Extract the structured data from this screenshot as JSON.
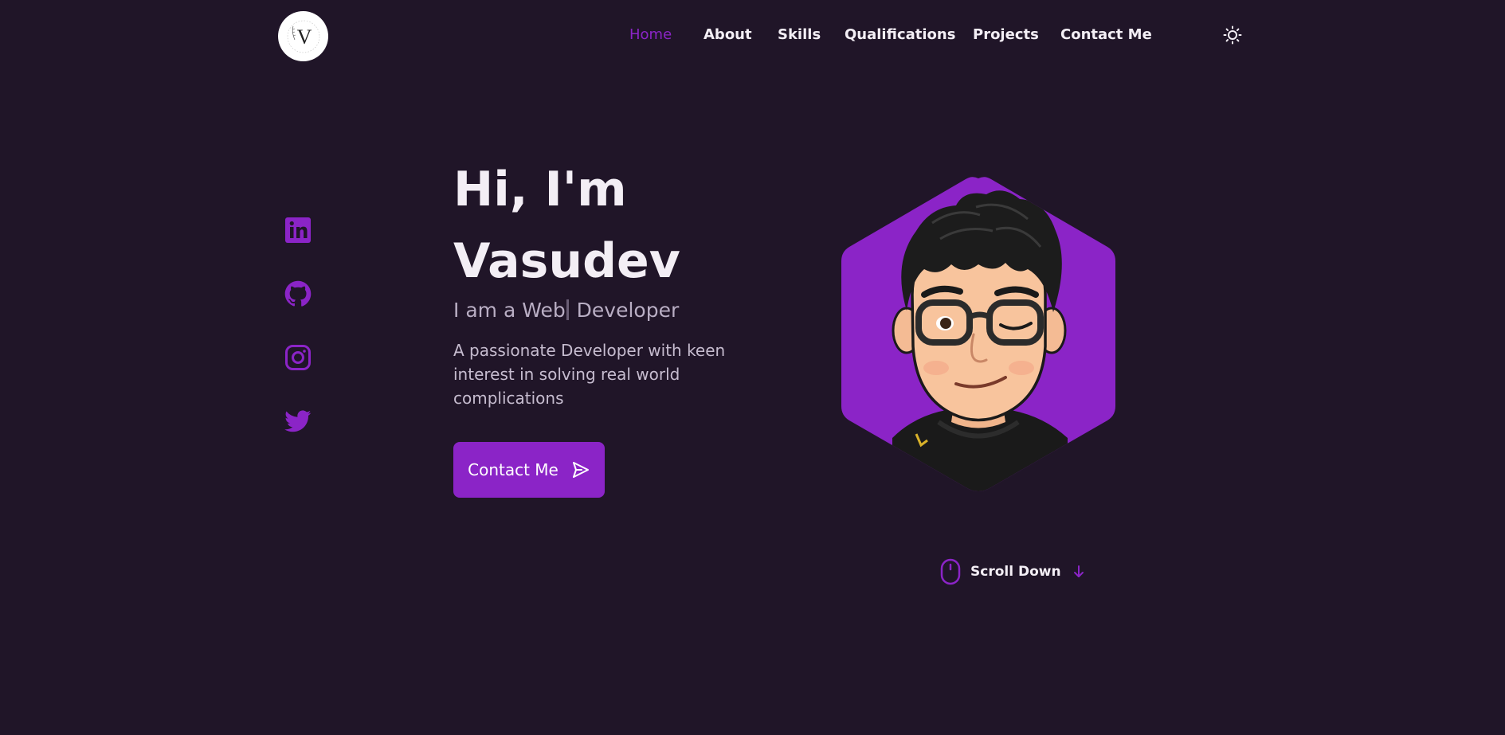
{
  "header": {
    "logo_letter": "V",
    "nav": [
      {
        "label": "Home",
        "active": true
      },
      {
        "label": "About",
        "active": false
      },
      {
        "label": "Skills",
        "active": false
      },
      {
        "label": "Qualifications",
        "active": false
      },
      {
        "label": "Projects",
        "active": false
      },
      {
        "label": "Contact Me",
        "active": false
      }
    ],
    "theme_icon": "sun-icon"
  },
  "social": [
    {
      "name": "linkedin-icon"
    },
    {
      "name": "github-icon"
    },
    {
      "name": "instagram-icon"
    },
    {
      "name": "twitter-icon"
    }
  ],
  "hero": {
    "greeting": "Hi, I'm",
    "name": "Vasudev",
    "subtitle_prefix": "I am a Web",
    "subtitle_suffix": " Developer",
    "description": "A passionate Developer with keen interest in solving real world complications",
    "cta_label": "Contact Me",
    "cta_icon": "send-icon"
  },
  "scroll": {
    "label": "Scroll Down",
    "mouse_icon": "mouse-icon",
    "arrow_icon": "arrow-down-icon"
  },
  "colors": {
    "background": "#201528",
    "accent": "#8b24c7",
    "text": "#f3eef5",
    "muted": "#b9aec4"
  }
}
